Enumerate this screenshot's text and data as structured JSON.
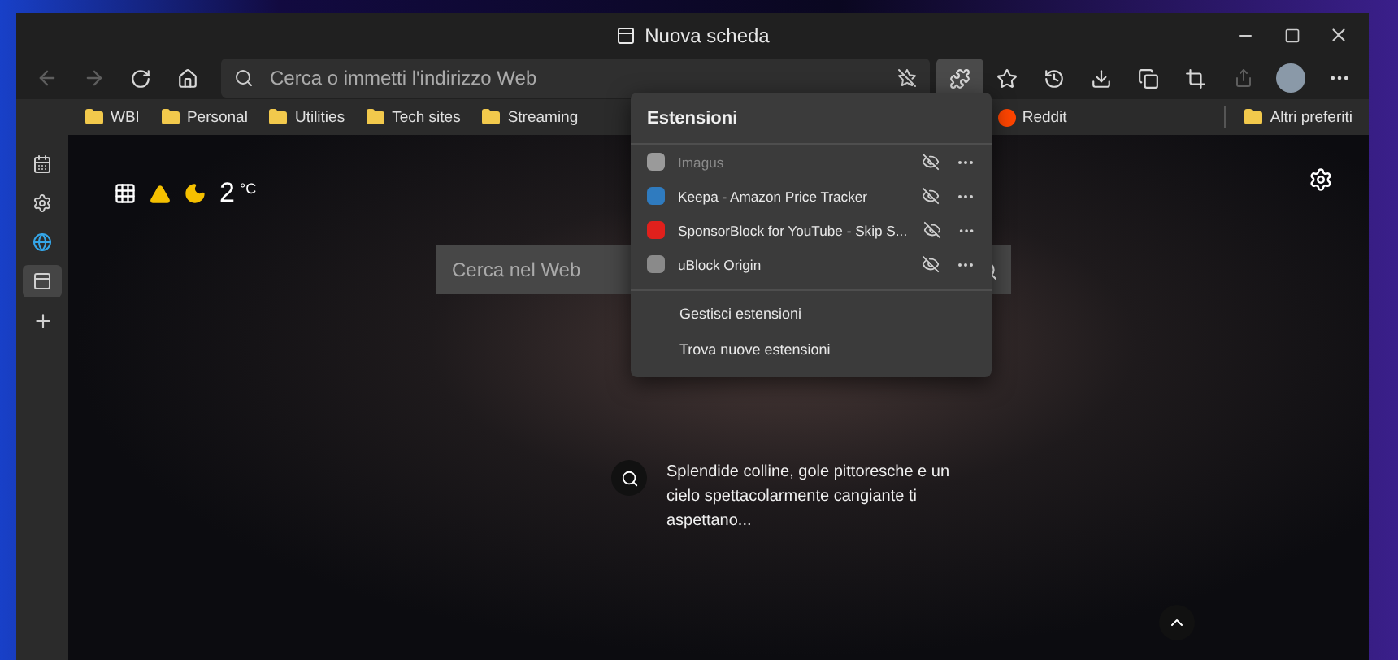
{
  "window": {
    "title": "Nuova scheda"
  },
  "toolbar": {
    "back_disabled": true,
    "forward_disabled": true,
    "address_placeholder": "Cerca o immetti l'indirizzo Web",
    "extensions_open": true,
    "share_disabled": true
  },
  "bookmarks": [
    {
      "label": "WBI",
      "kind": "folder"
    },
    {
      "label": "Personal",
      "kind": "folder"
    },
    {
      "label": "Utilities",
      "kind": "folder"
    },
    {
      "label": "Tech sites",
      "kind": "folder"
    },
    {
      "label": "Streaming",
      "kind": "folder"
    },
    {
      "label": "Reddit",
      "kind": "site"
    }
  ],
  "other_favorites": "Altri preferiti",
  "sidebar": {
    "items": [
      {
        "kind": "calendar",
        "selected": false
      },
      {
        "kind": "gear",
        "selected": false
      },
      {
        "kind": "edge",
        "selected": false
      },
      {
        "kind": "tab",
        "selected": true
      },
      {
        "kind": "plus",
        "selected": false
      }
    ]
  },
  "newtab": {
    "temperature": "2",
    "unit": "°C",
    "search_placeholder": "Cerca nel Web",
    "caption": "Splendide colline, gole pittoresche e un cielo spettacolarmente cangiante ti aspettano..."
  },
  "extensions_menu": {
    "title": "Estensioni",
    "items": [
      {
        "name": "Imagus",
        "enabled": false,
        "color": "#9a9a9a"
      },
      {
        "name": "Keepa - Amazon Price Tracker",
        "enabled": true,
        "color": "#2f7bbf"
      },
      {
        "name": "SponsorBlock for YouTube - Skip S...",
        "enabled": true,
        "color": "#e0201c"
      },
      {
        "name": "uBlock Origin",
        "enabled": true,
        "color": "#8a8a8a"
      }
    ],
    "links": [
      "Gestisci estensioni",
      "Trova nuove estensioni"
    ]
  }
}
